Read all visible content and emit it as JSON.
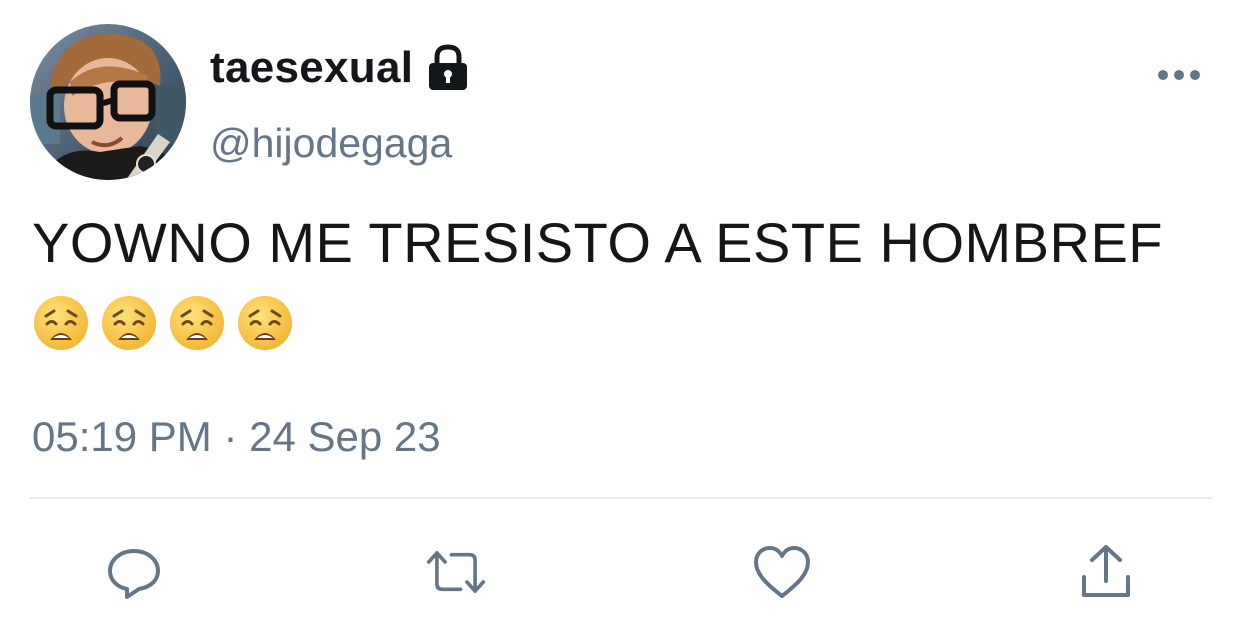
{
  "tweet": {
    "author": {
      "display_name": "taesexual",
      "handle": "@hijodegaga",
      "protected_icon": "lock-icon",
      "avatar": "avatar"
    },
    "text": "YOWNO ME TRESISTO A ESTE HOMBREF",
    "emojis": [
      "weary-face-emoji",
      "weary-face-emoji",
      "weary-face-emoji",
      "weary-face-emoji"
    ],
    "timestamp": "05:19 PM · 24 Sep 23"
  },
  "actions": {
    "reply_icon": "reply-icon",
    "retweet_icon": "retweet-icon",
    "like_icon": "heart-icon",
    "share_icon": "share-icon",
    "more_icon": "more-icon"
  },
  "colors": {
    "text": "#14171a",
    "secondary": "#657786",
    "divider": "#e6ecf0"
  }
}
